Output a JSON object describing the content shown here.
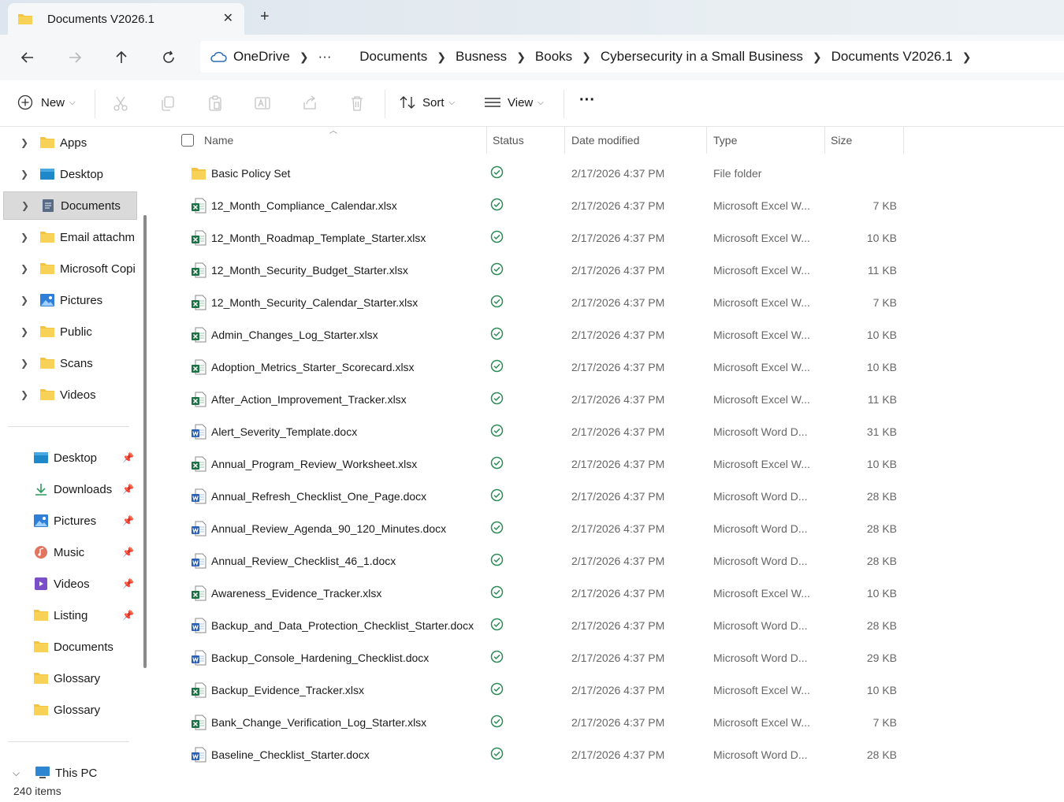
{
  "window": {
    "tab_title": "Documents V2026.1",
    "close_icon": "close-icon",
    "new_tab_icon": "plus-icon"
  },
  "nav": {
    "breadcrumbs": [
      "OneDrive",
      "···",
      "Documents",
      "Busness",
      "Books",
      "Cybersecurity in a Small Business",
      "Documents V2026.1"
    ]
  },
  "toolbar": {
    "new_label": "New",
    "sort_label": "Sort",
    "view_label": "View",
    "more_label": "···"
  },
  "sidebar": {
    "tree": [
      {
        "label": "Apps",
        "icon": "folder-icon"
      },
      {
        "label": "Desktop",
        "icon": "desktop-icon"
      },
      {
        "label": "Documents",
        "icon": "documents-icon",
        "selected": true
      },
      {
        "label": "Email attachm",
        "icon": "folder-icon"
      },
      {
        "label": "Microsoft Copi",
        "icon": "folder-icon"
      },
      {
        "label": "Pictures",
        "icon": "pictures-icon"
      },
      {
        "label": "Public",
        "icon": "folder-icon"
      },
      {
        "label": "Scans",
        "icon": "folder-icon"
      },
      {
        "label": "Videos",
        "icon": "folder-icon"
      }
    ],
    "quick_access": [
      {
        "label": "Desktop",
        "icon": "desktop-icon",
        "pinned": true
      },
      {
        "label": "Downloads",
        "icon": "download-icon",
        "pinned": true
      },
      {
        "label": "Pictures",
        "icon": "pictures-icon",
        "pinned": true
      },
      {
        "label": "Music",
        "icon": "music-icon",
        "pinned": true
      },
      {
        "label": "Videos",
        "icon": "videos-icon",
        "pinned": true
      },
      {
        "label": "Listing",
        "icon": "folder-icon",
        "pinned": true
      },
      {
        "label": "Documents",
        "icon": "folder-icon",
        "pinned": false
      },
      {
        "label": "Glossary",
        "icon": "folder-icon",
        "pinned": false
      },
      {
        "label": "Glossary",
        "icon": "folder-icon",
        "pinned": false
      }
    ],
    "this_pc": "This PC"
  },
  "columns": {
    "name": "Name",
    "status": "Status",
    "date": "Date modified",
    "type": "Type",
    "size": "Size"
  },
  "files": [
    {
      "name": "Basic Policy Set",
      "kind": "folder",
      "date": "2/17/2026 4:37 PM",
      "type": "File folder",
      "size": ""
    },
    {
      "name": "12_Month_Compliance_Calendar.xlsx",
      "kind": "excel",
      "date": "2/17/2026 4:37 PM",
      "type": "Microsoft Excel W...",
      "size": "7 KB"
    },
    {
      "name": "12_Month_Roadmap_Template_Starter.xlsx",
      "kind": "excel",
      "date": "2/17/2026 4:37 PM",
      "type": "Microsoft Excel W...",
      "size": "10 KB"
    },
    {
      "name": "12_Month_Security_Budget_Starter.xlsx",
      "kind": "excel",
      "date": "2/17/2026 4:37 PM",
      "type": "Microsoft Excel W...",
      "size": "11 KB"
    },
    {
      "name": "12_Month_Security_Calendar_Starter.xlsx",
      "kind": "excel",
      "date": "2/17/2026 4:37 PM",
      "type": "Microsoft Excel W...",
      "size": "7 KB"
    },
    {
      "name": "Admin_Changes_Log_Starter.xlsx",
      "kind": "excel",
      "date": "2/17/2026 4:37 PM",
      "type": "Microsoft Excel W...",
      "size": "10 KB"
    },
    {
      "name": "Adoption_Metrics_Starter_Scorecard.xlsx",
      "kind": "excel",
      "date": "2/17/2026 4:37 PM",
      "type": "Microsoft Excel W...",
      "size": "10 KB"
    },
    {
      "name": "After_Action_Improvement_Tracker.xlsx",
      "kind": "excel",
      "date": "2/17/2026 4:37 PM",
      "type": "Microsoft Excel W...",
      "size": "11 KB"
    },
    {
      "name": "Alert_Severity_Template.docx",
      "kind": "word",
      "date": "2/17/2026 4:37 PM",
      "type": "Microsoft Word D...",
      "size": "31 KB"
    },
    {
      "name": "Annual_Program_Review_Worksheet.xlsx",
      "kind": "excel",
      "date": "2/17/2026 4:37 PM",
      "type": "Microsoft Excel W...",
      "size": "10 KB"
    },
    {
      "name": "Annual_Refresh_Checklist_One_Page.docx",
      "kind": "word",
      "date": "2/17/2026 4:37 PM",
      "type": "Microsoft Word D...",
      "size": "28 KB"
    },
    {
      "name": "Annual_Review_Agenda_90_120_Minutes.docx",
      "kind": "word",
      "date": "2/17/2026 4:37 PM",
      "type": "Microsoft Word D...",
      "size": "28 KB"
    },
    {
      "name": "Annual_Review_Checklist_46_1.docx",
      "kind": "word",
      "date": "2/17/2026 4:37 PM",
      "type": "Microsoft Word D...",
      "size": "28 KB"
    },
    {
      "name": "Awareness_Evidence_Tracker.xlsx",
      "kind": "excel",
      "date": "2/17/2026 4:37 PM",
      "type": "Microsoft Excel W...",
      "size": "10 KB"
    },
    {
      "name": "Backup_and_Data_Protection_Checklist_Starter.docx",
      "kind": "word",
      "date": "2/17/2026 4:37 PM",
      "type": "Microsoft Word D...",
      "size": "28 KB"
    },
    {
      "name": "Backup_Console_Hardening_Checklist.docx",
      "kind": "word",
      "date": "2/17/2026 4:37 PM",
      "type": "Microsoft Word D...",
      "size": "29 KB"
    },
    {
      "name": "Backup_Evidence_Tracker.xlsx",
      "kind": "excel",
      "date": "2/17/2026 4:37 PM",
      "type": "Microsoft Excel W...",
      "size": "10 KB"
    },
    {
      "name": "Bank_Change_Verification_Log_Starter.xlsx",
      "kind": "excel",
      "date": "2/17/2026 4:37 PM",
      "type": "Microsoft Excel W...",
      "size": "7 KB"
    },
    {
      "name": "Baseline_Checklist_Starter.docx",
      "kind": "word",
      "date": "2/17/2026 4:37 PM",
      "type": "Microsoft Word D...",
      "size": "28 KB"
    }
  ],
  "status_bar": {
    "item_count": "240 items"
  },
  "colors": {
    "folder": "#f4c542",
    "excel": "#1d7044",
    "word": "#2b5fb4",
    "synced": "#2e8b57",
    "selected_bg": "#dadada"
  }
}
